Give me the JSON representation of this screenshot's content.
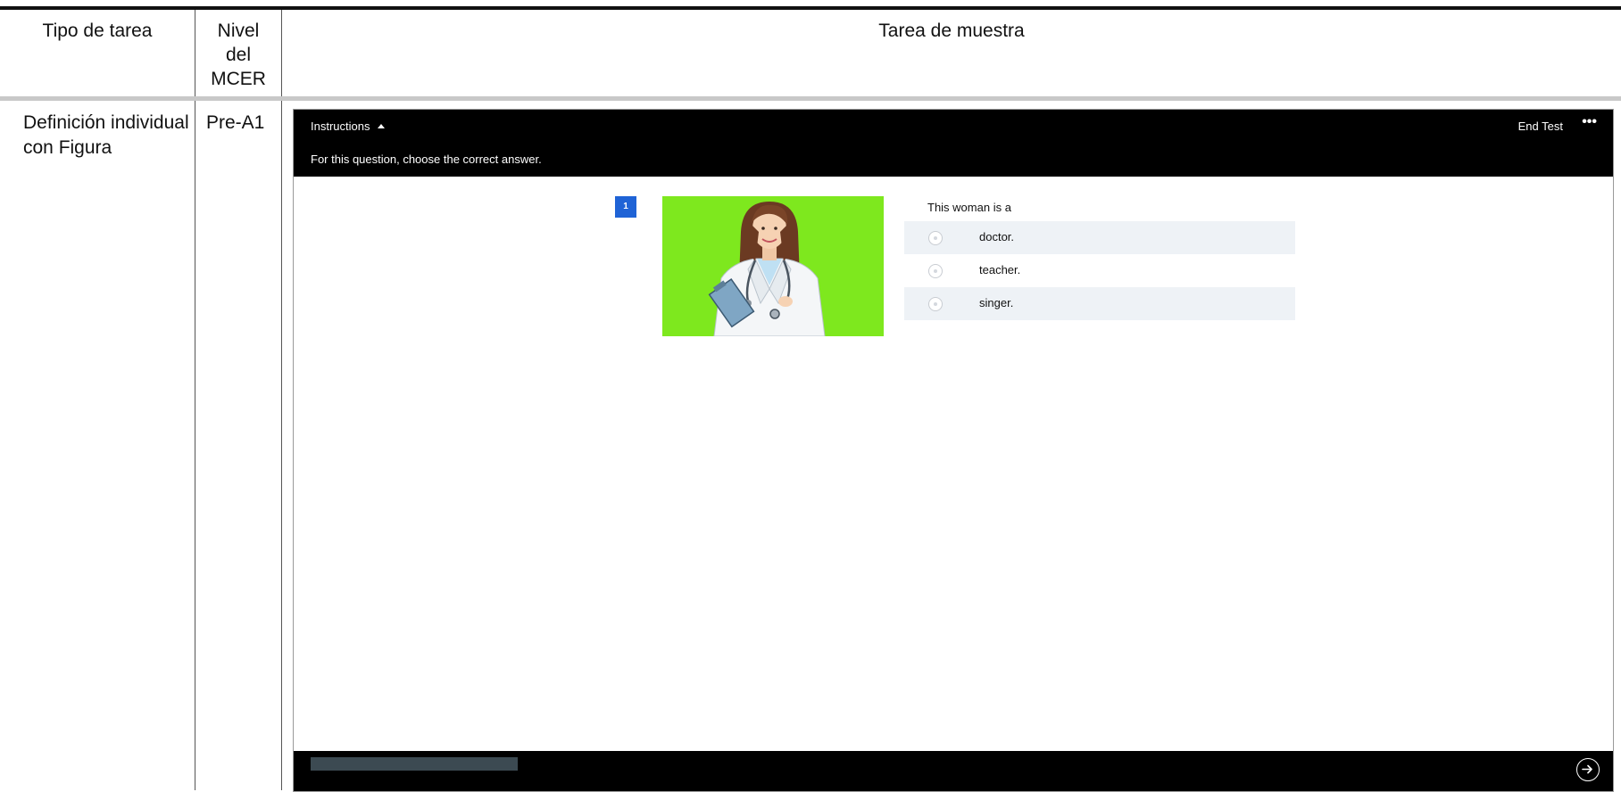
{
  "table": {
    "headers": {
      "task_type": "Tipo de tarea",
      "level_line1": "Nivel",
      "level_line2": "del",
      "level_line3": "MCER",
      "sample": "Tarea de muestra"
    },
    "row": {
      "task_type": "Definición individual con Figura",
      "level": "Pre-A1"
    }
  },
  "test_ui": {
    "instructions_toggle": "Instructions",
    "instructions_text": "For this question, choose the correct answer.",
    "end_test": "End Test",
    "more_menu": "•••",
    "question_number": "1",
    "prompt": "This woman is a",
    "options": [
      "doctor.",
      "teacher.",
      "singer."
    ],
    "figure_background": "#7ee81e",
    "accent": "#1f63d6"
  }
}
